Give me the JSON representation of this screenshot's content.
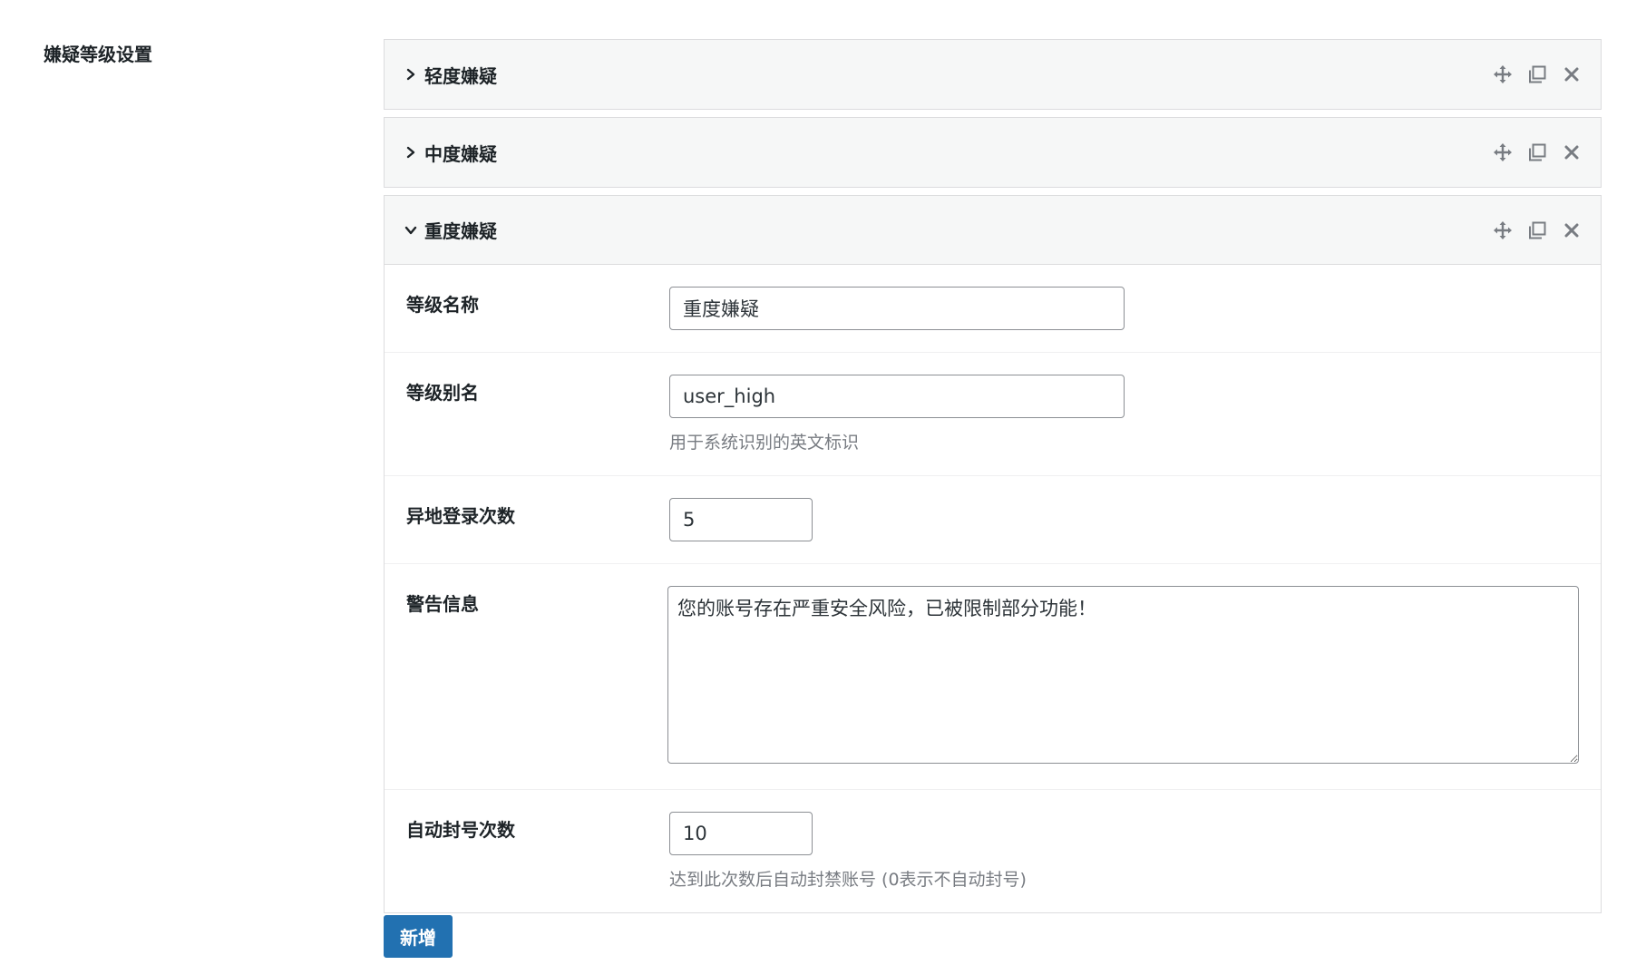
{
  "section": {
    "label": "嫌疑等级设置"
  },
  "groups": [
    {
      "title": "轻度嫌疑",
      "expanded": false
    },
    {
      "title": "中度嫌疑",
      "expanded": false
    },
    {
      "title": "重度嫌疑",
      "expanded": true
    }
  ],
  "icons": {
    "collapsed": "chevron-right-icon",
    "expanded": "chevron-down-icon",
    "move": "move-icon",
    "duplicate": "duplicate-icon",
    "remove": "close-icon"
  },
  "form": {
    "level_name": {
      "label": "等级名称",
      "value": "重度嫌疑"
    },
    "level_alias": {
      "label": "等级别名",
      "value": "user_high",
      "help": "用于系统识别的英文标识"
    },
    "login_count": {
      "label": "异地登录次数",
      "value": "5"
    },
    "warning": {
      "label": "警告信息",
      "value": "您的账号存在严重安全风险，已被限制部分功能！"
    },
    "auto_ban": {
      "label": "自动封号次数",
      "value": "10",
      "help": "达到此次数后自动封禁账号 (0表示不自动封号)"
    }
  },
  "add_button": {
    "label": "新增"
  },
  "colors": {
    "accent": "#2271b1",
    "header_bg": "#f6f7f7",
    "border": "#dcdcde",
    "icon": "#787c82"
  }
}
